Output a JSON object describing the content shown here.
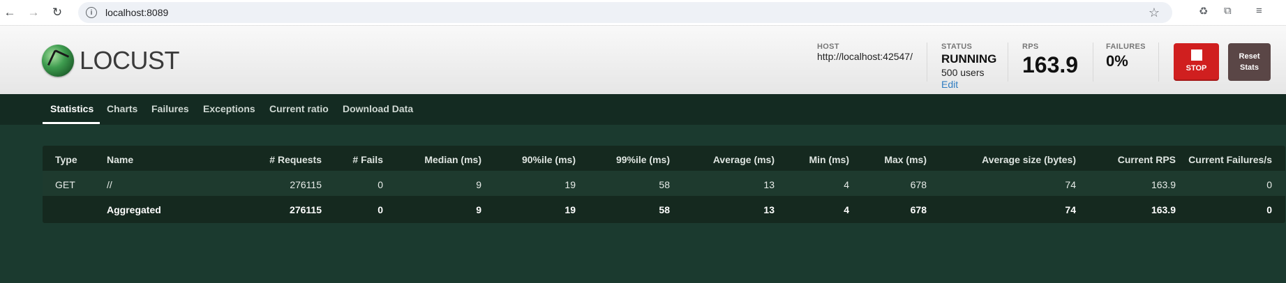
{
  "browser": {
    "url": "localhost:8089"
  },
  "header": {
    "logo_text": "LOCUST",
    "host_label": "HOST",
    "host_value": "http://localhost:42547/",
    "status_label": "STATUS",
    "status_value": "RUNNING",
    "users": "500 users",
    "edit": "Edit",
    "rps_label": "RPS",
    "rps_value": "163.9",
    "failures_label": "FAILURES",
    "failures_value": "0%",
    "stop_label": "STOP",
    "reset_label_1": "Reset",
    "reset_label_2": "Stats"
  },
  "tabs": [
    {
      "label": "Statistics",
      "active": true
    },
    {
      "label": "Charts"
    },
    {
      "label": "Failures"
    },
    {
      "label": "Exceptions"
    },
    {
      "label": "Current ratio"
    },
    {
      "label": "Download Data"
    }
  ],
  "table": {
    "headers": [
      "Type",
      "Name",
      "# Requests",
      "# Fails",
      "Median (ms)",
      "90%ile (ms)",
      "99%ile (ms)",
      "Average (ms)",
      "Min (ms)",
      "Max (ms)",
      "Average size (bytes)",
      "Current RPS",
      "Current Failures/s"
    ],
    "rows": [
      [
        "GET",
        "//",
        "276115",
        "0",
        "9",
        "19",
        "58",
        "13",
        "4",
        "678",
        "74",
        "163.9",
        "0"
      ]
    ],
    "aggregated": [
      "",
      "Aggregated",
      "276115",
      "0",
      "9",
      "19",
      "58",
      "13",
      "4",
      "678",
      "74",
      "163.9",
      "0"
    ]
  },
  "colors": {
    "page_bg": "#1b3a2f",
    "tabs_bg": "#142b22",
    "stop": "#d01f1f",
    "reset": "#5a4646",
    "link": "#2d7cc1"
  }
}
